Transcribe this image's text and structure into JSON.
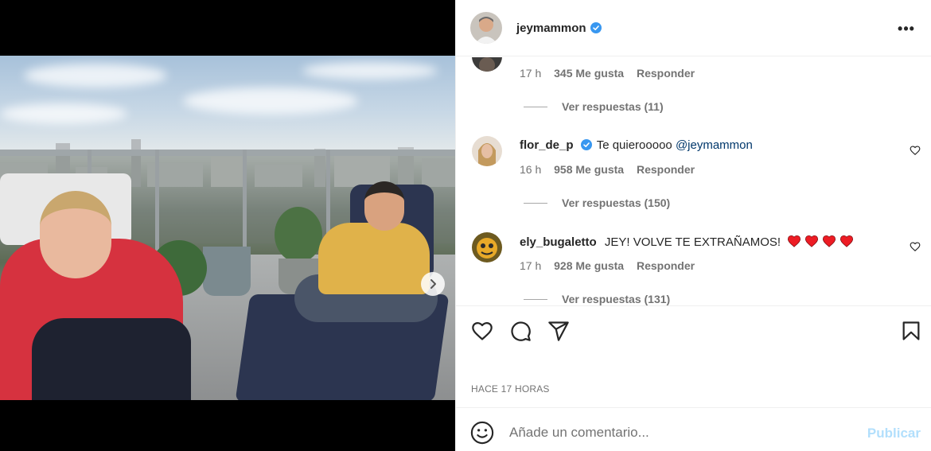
{
  "header": {
    "username": "jeymammon",
    "more_label": "•••",
    "avatar_icon": "profile-avatar-icon",
    "verified_color": "#3897f0"
  },
  "comments": [
    {
      "partial": true,
      "time": "17 h",
      "likes": "345 Me gusta",
      "reply": "Responder",
      "view_replies": "Ver respuestas (11)"
    },
    {
      "username": "flor_de_p",
      "verified": true,
      "text": "Te quierooooo ",
      "mention": "@jeymammon",
      "time": "16 h",
      "likes": "958 Me gusta",
      "reply": "Responder",
      "view_replies": "Ver respuestas (150)"
    },
    {
      "username": "ely_bugaletto",
      "verified": false,
      "text": "JEY! VOLVE TE EXTRAÑAMOS!",
      "hearts": 4,
      "time": "17 h",
      "likes": "928 Me gusta",
      "reply": "Responder",
      "view_replies": "Ver respuestas (131)"
    }
  ],
  "actions": {
    "like_icon": "heart-icon",
    "comment_icon": "comment-icon",
    "share_icon": "send-icon",
    "save_icon": "bookmark-icon"
  },
  "post_time": "HACE 17 HORAS",
  "add_comment": {
    "placeholder": "Añade un comentario...",
    "publish_label": "Publicar",
    "emoji_icon": "smiley-icon"
  },
  "carousel": {
    "total": 2,
    "current": 1,
    "next_icon": "chevron-right-icon"
  },
  "colors": {
    "link": "#00376b",
    "muted": "#737373",
    "publish_disabled": "#b2dffc",
    "heart_red": "#ed1c24"
  }
}
